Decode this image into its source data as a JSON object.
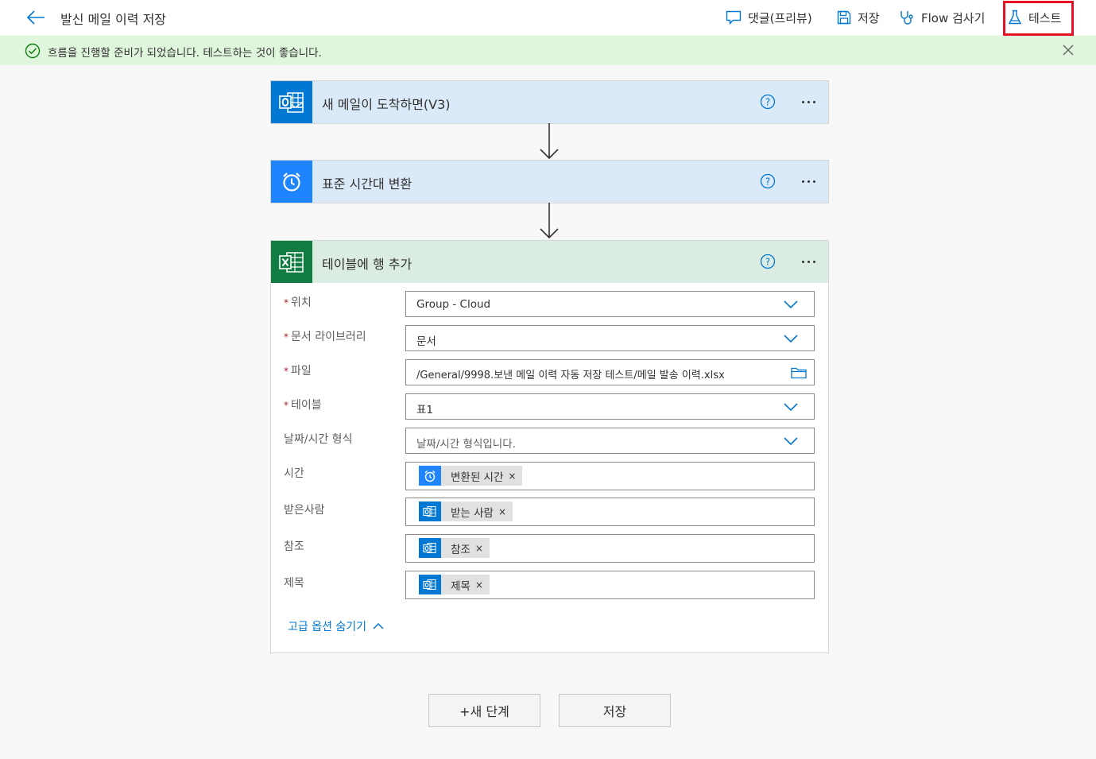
{
  "header": {
    "title": "발신 메일 이력 저장",
    "comments_label": "댓글(프리뷰)",
    "save_label": "저장",
    "checker_label": "Flow 검사기",
    "test_label": "테스트"
  },
  "banner": {
    "message": "흐름을 진행할 준비가 되었습니다. 테스트하는 것이 좋습니다."
  },
  "steps": [
    {
      "title": "새 메일이 도착하면(V3)",
      "icon": "outlook-icon",
      "color": "#0078d4"
    },
    {
      "title": "표준 시간대 변환",
      "icon": "alarm-clock-icon",
      "color": "#1f85ff"
    },
    {
      "title": "테이블에 행 추가",
      "icon": "excel-icon",
      "color": "#107c41"
    }
  ],
  "form": {
    "location": {
      "label": "위치",
      "value": "Group - Cloud"
    },
    "library": {
      "label": "문서 라이브러리",
      "value": "문서"
    },
    "file": {
      "label": "파일",
      "value": "/General/9998.보낸 메일 이력 자동 저장 테스트/메일 발송 이력.xlsx"
    },
    "table": {
      "label": "테이블",
      "value": "표1"
    },
    "datetime": {
      "label": "날짜/시간 형식",
      "placeholder": "날짜/시간 형식입니다."
    },
    "time": {
      "label": "시간",
      "token": "변환된 시간"
    },
    "to": {
      "label": "받은사람",
      "token": "받는 사람"
    },
    "cc": {
      "label": "참조",
      "token": "참조"
    },
    "subject": {
      "label": "제목",
      "token": "제목"
    },
    "required_mark": "*",
    "token_remove": "×",
    "advanced_label": "고급 옵션 숨기기"
  },
  "footer": {
    "new_step_label": "+새 단계",
    "save_label": "저장"
  },
  "colors": {
    "accent": "#0078d4",
    "banner_bg": "#dff6dd",
    "success": "#107c10",
    "highlight_box": "#e81123"
  }
}
